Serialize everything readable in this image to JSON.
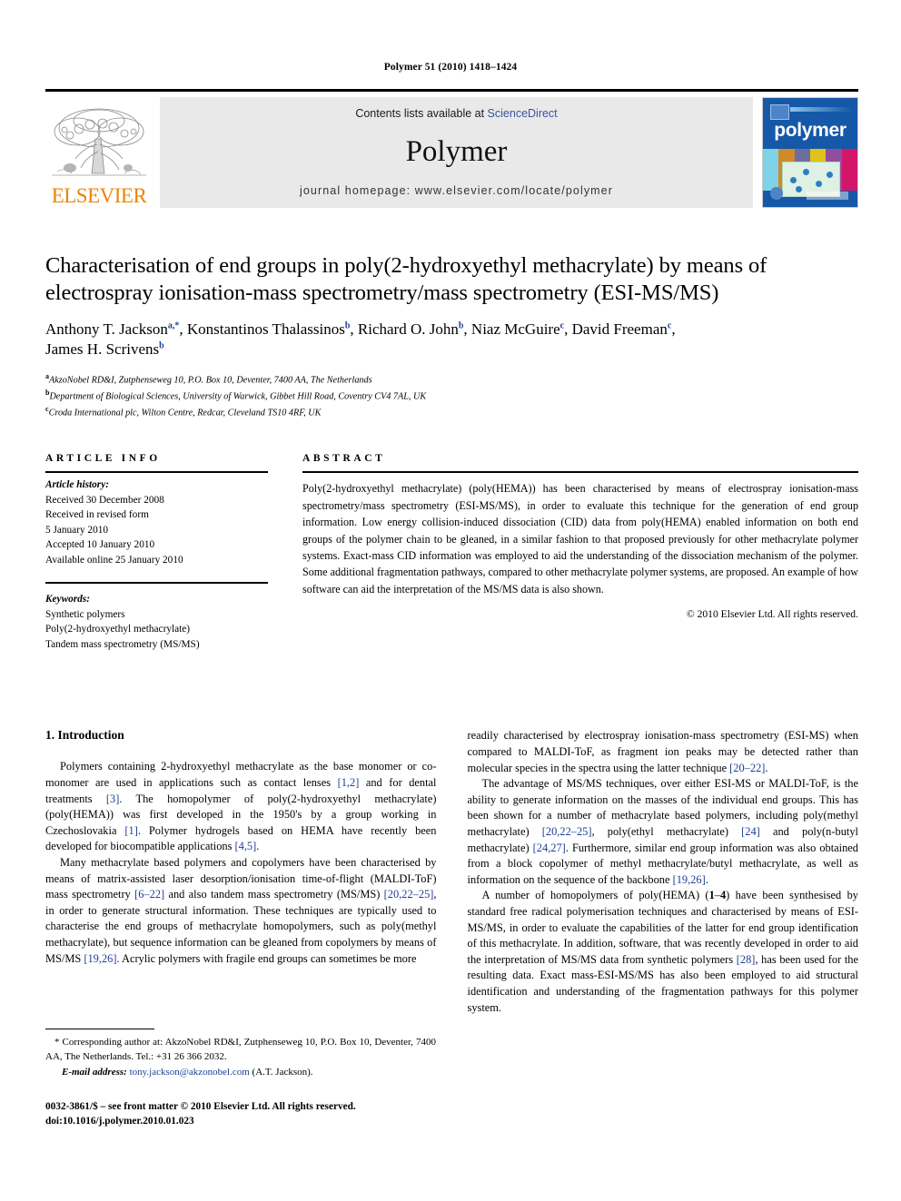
{
  "running_head": "Polymer 51 (2010) 1418–1424",
  "masthead": {
    "contents_prefix": "Contents lists available at ",
    "sciencedirect": "ScienceDirect",
    "journal_title": "Polymer",
    "homepage": "journal homepage: www.elsevier.com/locate/polymer",
    "publisher_word": "ELSEVIER",
    "cover_title": "polymer",
    "accent_orange": "#ef8200",
    "accent_link": "#3a53a4",
    "cover_blue": "#1558a8"
  },
  "article": {
    "title": "Characterisation of end groups in poly(2-hydroxyethyl methacrylate) by means of electrospray ionisation-mass spectrometry/mass spectrometry (ESI-MS/MS)",
    "authors_line1_pre": "Anthony T. Jackson",
    "authors": "Anthony T. Jackson a,*, Konstantinos Thalassinos b, Richard O. John b, Niaz McGuire c, David Freeman c, James H. Scrivens b",
    "affiliations": [
      {
        "mark": "a",
        "text": "AkzoNobel RD&I, Zutphenseweg 10, P.O. Box 10, Deventer, 7400 AA, The Netherlands"
      },
      {
        "mark": "b",
        "text": "Department of Biological Sciences, University of Warwick, Gibbet Hill Road, Coventry CV4 7AL, UK"
      },
      {
        "mark": "c",
        "text": "Croda International plc, Wilton Centre, Redcar, Cleveland TS10 4RF, UK"
      }
    ]
  },
  "article_info": {
    "heading": "ARTICLE INFO",
    "history_label": "Article history:",
    "history": [
      "Received 30 December 2008",
      "Received in revised form",
      "5 January 2010",
      "Accepted 10 January 2010",
      "Available online 25 January 2010"
    ],
    "keywords_label": "Keywords:",
    "keywords": [
      "Synthetic polymers",
      "Poly(2-hydroxyethyl methacrylate)",
      "Tandem mass spectrometry (MS/MS)"
    ]
  },
  "abstract": {
    "heading": "ABSTRACT",
    "text": "Poly(2-hydroxyethyl methacrylate) (poly(HEMA)) has been characterised by means of electrospray ionisation-mass spectrometry/mass spectrometry (ESI-MS/MS), in order to evaluate this technique for the generation of end group information. Low energy collision-induced dissociation (CID) data from poly(HEMA) enabled information on both end groups of the polymer chain to be gleaned, in a similar fashion to that proposed previously for other methacrylate polymer systems. Exact-mass CID information was employed to aid the understanding of the dissociation mechanism of the polymer. Some additional fragmentation pathways, compared to other methacrylate polymer systems, are proposed. An example of how software can aid the interpretation of the MS/MS data is also shown.",
    "copyright": "© 2010 Elsevier Ltd. All rights reserved."
  },
  "introduction": {
    "heading": "1. Introduction",
    "left_paragraphs": [
      "Polymers containing 2-hydroxyethyl methacrylate as the base monomer or co-monomer are used in applications such as contact lenses [1,2] and for dental treatments [3]. The homopolymer of poly(2-hydroxyethyl methacrylate) (poly(HEMA)) was first developed in the 1950's by a group working in Czechoslovakia [1]. Polymer hydrogels based on HEMA have recently been developed for biocompatible applications [4,5].",
      "Many methacrylate based polymers and copolymers have been characterised by means of matrix-assisted laser desorption/ionisation time-of-flight (MALDI-ToF) mass spectrometry [6–22] and also tandem mass spectrometry (MS/MS) [20,22–25], in order to generate structural information. These techniques are typically used to characterise the end groups of methacrylate homopolymers, such as poly(methyl methacrylate), but sequence information can be gleaned from copolymers by means of MS/MS [19,26]. Acrylic polymers with fragile end groups can sometimes be more"
    ],
    "right_paragraphs": [
      "readily characterised by electrospray ionisation-mass spectrometry (ESI-MS) when compared to MALDI-ToF, as fragment ion peaks may be detected rather than molecular species in the spectra using the latter technique [20–22].",
      "The advantage of MS/MS techniques, over either ESI-MS or MALDI-ToF, is the ability to generate information on the masses of the individual end groups. This has been shown for a number of methacrylate based polymers, including poly(methyl methacrylate) [20,22–25], poly(ethyl methacrylate) [24] and poly(n-butyl methacrylate) [24,27]. Furthermore, similar end group information was also obtained from a block copolymer of methyl methacrylate/butyl methacrylate, as well as information on the sequence of the backbone [19,26].",
      "A number of homopolymers of poly(HEMA) (1–4) have been synthesised by standard free radical polymerisation techniques and characterised by means of ESI-MS/MS, in order to evaluate the capabilities of the latter for end group identification of this methacrylate. In addition, software, that was recently developed in order to aid the interpretation of MS/MS data from synthetic polymers [28], has been used for the resulting data. Exact mass-ESI-MS/MS has also been employed to aid structural identification and understanding of the fragmentation pathways for this polymer system."
    ]
  },
  "footnote": {
    "corresponding": "* Corresponding author at: AkzoNobel RD&I, Zutphenseweg 10, P.O. Box 10, Deventer, 7400 AA, The Netherlands. Tel.: +31 26 366 2032.",
    "email_label": "E-mail address:",
    "email": "tony.jackson@akzonobel.com",
    "email_suffix": "(A.T. Jackson)."
  },
  "footer": {
    "line1": "0032-3861/$ – see front matter © 2010 Elsevier Ltd. All rights reserved.",
    "line2": "doi:10.1016/j.polymer.2010.01.023"
  }
}
